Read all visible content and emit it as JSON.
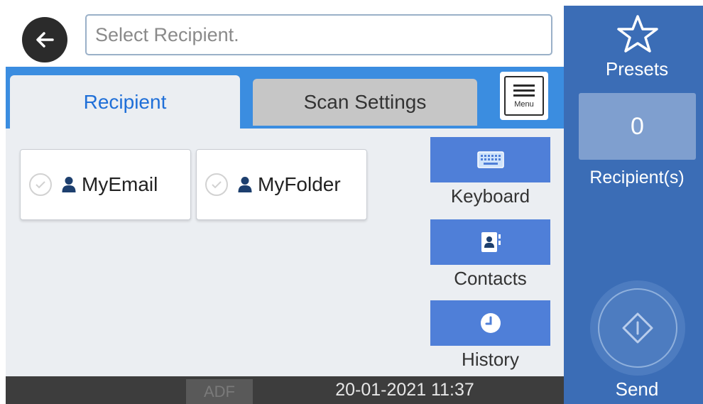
{
  "search": {
    "placeholder": "Select Recipient."
  },
  "tabs": [
    {
      "label": "Recipient",
      "active": true
    },
    {
      "label": "Scan Settings",
      "active": false
    }
  ],
  "menu": {
    "label": "Menu",
    "icon": "menu-icon"
  },
  "recipients": [
    {
      "label": "MyEmail",
      "icon": "person-icon",
      "checked": false
    },
    {
      "label": "MyFolder",
      "icon": "person-icon",
      "checked": false
    }
  ],
  "side_buttons": [
    {
      "label": "Keyboard",
      "icon": "keyboard-icon"
    },
    {
      "label": "Contacts",
      "icon": "contacts-icon"
    },
    {
      "label": "History",
      "icon": "clock-icon"
    }
  ],
  "footer": {
    "source": "ADF",
    "datetime": "20-01-2021 11:37"
  },
  "right_panel": {
    "presets_label": "Presets",
    "recipient_count": "0",
    "recipient_count_label": "Recipient(s)",
    "send_label": "Send"
  },
  "colors": {
    "tab_strip": "#3b8de0",
    "right_panel": "#3b6db6",
    "side_button": "#4f7fd8",
    "active_tab_text": "#1f6fd8",
    "footer": "#3d3d3d"
  }
}
